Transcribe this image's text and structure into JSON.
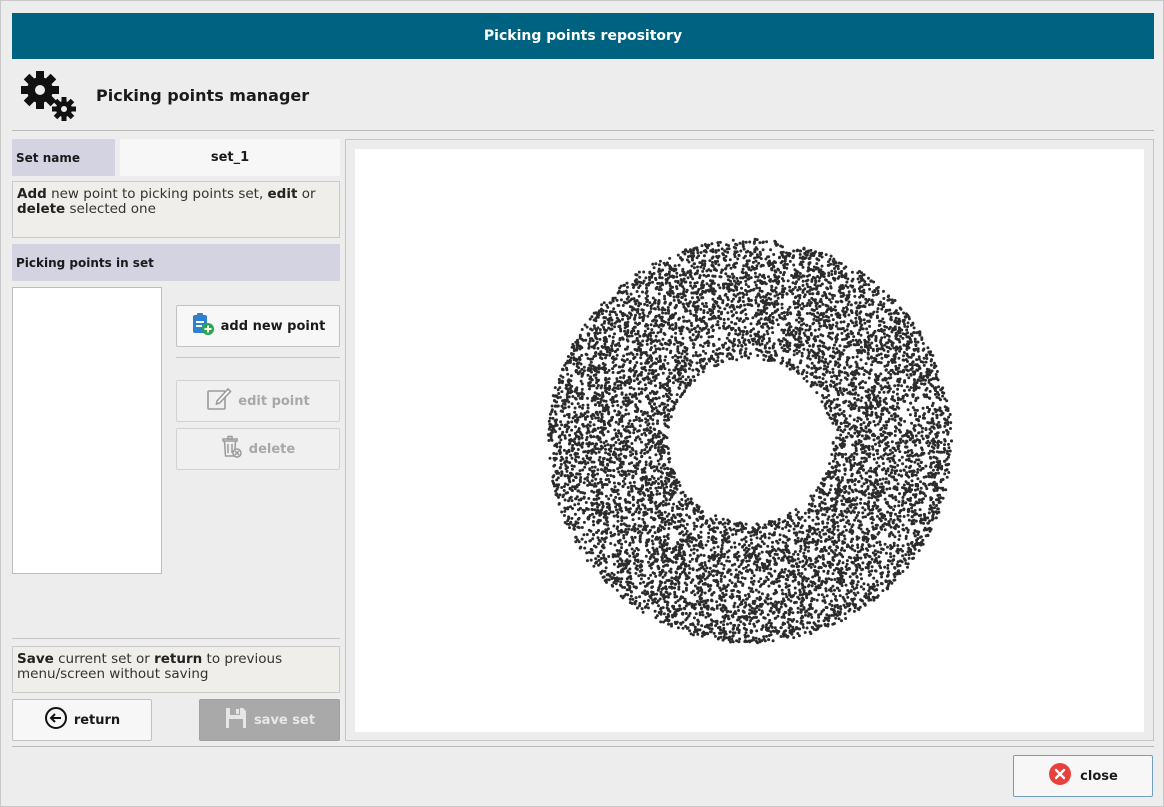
{
  "window": {
    "title": "Picking points repository"
  },
  "header": {
    "title": "Picking points manager",
    "icon": "gears-icon"
  },
  "set": {
    "label": "Set name",
    "value": "set_1"
  },
  "instructions": {
    "add_word": "Add",
    "add_text": " new point to picking points set, ",
    "edit_word": "edit",
    "edit_text": " or ",
    "delete_word": "delete",
    "delete_text": " selected one"
  },
  "points_section": {
    "label": "Picking points in set",
    "items": []
  },
  "buttons": {
    "add_point": "add new point",
    "edit_point": "edit point",
    "delete": "delete",
    "return": "return",
    "save_set": "save set",
    "close": "close"
  },
  "save_info": {
    "save_word": "Save",
    "save_text": " current set or ",
    "return_word": "return",
    "return_text": " to previous menu/screen without saving"
  },
  "colors": {
    "titlebar": "#006281",
    "label_bg": "#d3d3e1",
    "close_icon": "#e8403a",
    "add_icon_blue": "#2f7fd0",
    "add_icon_green": "#2aa64a",
    "point_cloud": "#2b2b2b"
  }
}
